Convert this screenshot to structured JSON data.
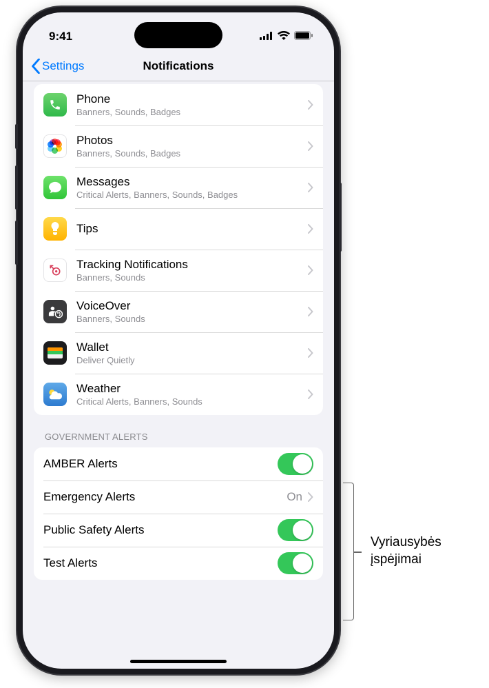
{
  "status": {
    "time": "9:41"
  },
  "nav": {
    "back": "Settings",
    "title": "Notifications"
  },
  "apps": [
    {
      "name": "Phone",
      "sub": "Banners, Sounds, Badges",
      "iconClass": "icon-phone",
      "icon": "phone"
    },
    {
      "name": "Photos",
      "sub": "Banners, Sounds, Badges",
      "iconClass": "icon-photos",
      "icon": "photos"
    },
    {
      "name": "Messages",
      "sub": "Critical Alerts, Banners, Sounds, Badges",
      "iconClass": "icon-messages",
      "icon": "messages"
    },
    {
      "name": "Tips",
      "sub": "",
      "iconClass": "icon-tips",
      "icon": "tips"
    },
    {
      "name": "Tracking Notifications",
      "sub": "Banners, Sounds",
      "iconClass": "icon-tracking",
      "icon": "tracking"
    },
    {
      "name": "VoiceOver",
      "sub": "Banners, Sounds",
      "iconClass": "icon-voiceover",
      "icon": "voiceover"
    },
    {
      "name": "Wallet",
      "sub": "Deliver Quietly",
      "iconClass": "icon-wallet",
      "icon": "wallet"
    },
    {
      "name": "Weather",
      "sub": "Critical Alerts, Banners, Sounds",
      "iconClass": "icon-weather",
      "icon": "weather"
    }
  ],
  "govHeader": "Government Alerts",
  "gov": [
    {
      "label": "AMBER Alerts",
      "type": "toggle",
      "on": true
    },
    {
      "label": "Emergency Alerts",
      "type": "link",
      "value": "On"
    },
    {
      "label": "Public Safety Alerts",
      "type": "toggle",
      "on": true
    },
    {
      "label": "Test Alerts",
      "type": "toggle",
      "on": true
    }
  ],
  "callout": "Vyriausybės\nįspėjimai"
}
